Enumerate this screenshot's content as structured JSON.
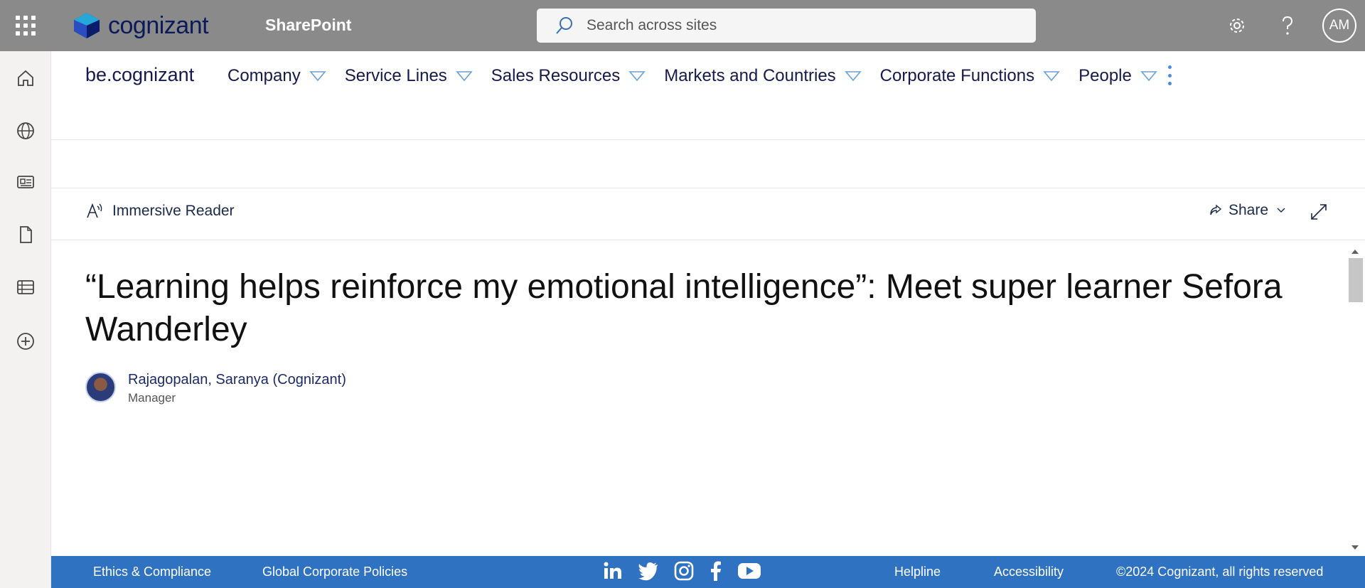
{
  "suite": {
    "logo_text": "cognizant",
    "app_name": "SharePoint",
    "search_placeholder": "Search across sites",
    "avatar_initials": "AM"
  },
  "site": {
    "name": "be.cognizant",
    "nav": [
      {
        "label": "Company"
      },
      {
        "label": "Service Lines"
      },
      {
        "label": "Sales Resources"
      },
      {
        "label": "Markets and Countries"
      },
      {
        "label": "Corporate Functions"
      },
      {
        "label": "People"
      }
    ]
  },
  "commandbar": {
    "immersive_reader": "Immersive Reader",
    "share": "Share"
  },
  "article": {
    "title": "“Learning helps reinforce my emotional intelligence”: Meet super learner Sefora Wanderley",
    "author_name": "Rajagopalan, Saranya (Cognizant)",
    "author_role": "Manager"
  },
  "footer": {
    "ethics": "Ethics & Compliance",
    "policies": "Global Corporate Policies",
    "helpline": "Helpline",
    "accessibility": "Accessibility",
    "copyright": "©2024 Cognizant, all rights reserved"
  },
  "icons": {
    "rail": [
      "home-icon",
      "globe-icon",
      "news-icon",
      "document-icon",
      "list-icon",
      "add-circle-icon"
    ],
    "socials": [
      "linkedin-icon",
      "twitter-icon",
      "instagram-icon",
      "facebook-icon",
      "youtube-icon"
    ]
  },
  "colors": {
    "suite_bar": "#8a8a8a",
    "footer": "#2f72c2",
    "nav_chevron": "#6a9fd8"
  }
}
